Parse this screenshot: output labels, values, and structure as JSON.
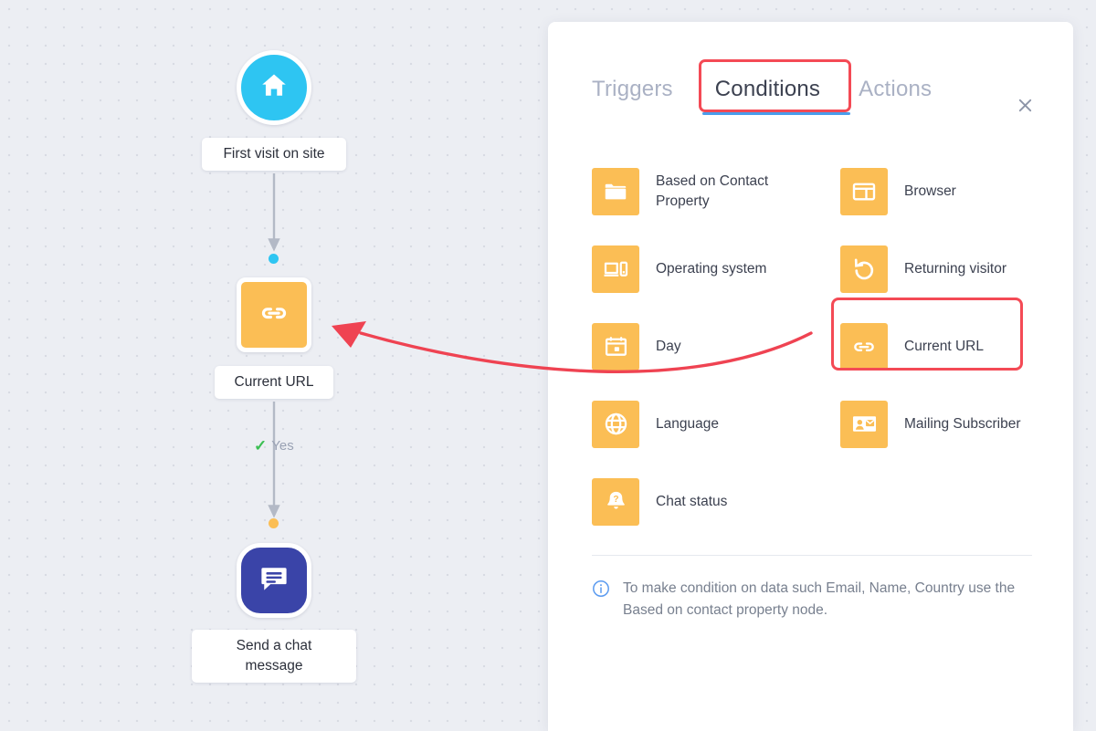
{
  "canvas": {
    "nodes": [
      {
        "id": "first-visit",
        "label": "First visit on site",
        "icon": "home-icon",
        "color": "#2ec5f2",
        "shape": "circle"
      },
      {
        "id": "current-url",
        "label": "Current URL",
        "icon": "link-icon",
        "color": "#fbbe55",
        "shape": "square"
      },
      {
        "id": "send-chat",
        "label": "Send a chat message",
        "icon": "chat-message-icon",
        "color": "#3a44a8",
        "shape": "rounded"
      }
    ],
    "branch_label": "Yes",
    "markers": [
      {
        "id": "marker-blue",
        "color": "#2ec5f2"
      },
      {
        "id": "marker-orange",
        "color": "#fbbe55"
      }
    ]
  },
  "panel": {
    "tabs": [
      {
        "id": "triggers",
        "label": "Triggers",
        "active": false
      },
      {
        "id": "conditions",
        "label": "Conditions",
        "active": true
      },
      {
        "id": "actions",
        "label": "Actions",
        "active": false
      }
    ],
    "close_label": "×",
    "conditions": [
      {
        "id": "based-on-contact-property",
        "label": "Based on Contact Property",
        "icon": "folder-icon",
        "column": "left"
      },
      {
        "id": "browser",
        "label": "Browser",
        "icon": "browser-icon",
        "column": "right"
      },
      {
        "id": "operating-system",
        "label": "Operating system",
        "icon": "devices-icon",
        "column": "left"
      },
      {
        "id": "returning-visitor",
        "label": "Returning visitor",
        "icon": "refresh-back-icon",
        "column": "right"
      },
      {
        "id": "day",
        "label": "Day",
        "icon": "calendar-icon",
        "column": "left"
      },
      {
        "id": "current-url",
        "label": "Current URL",
        "icon": "link-icon",
        "column": "right"
      },
      {
        "id": "language",
        "label": "Language",
        "icon": "globe-icon",
        "column": "left"
      },
      {
        "id": "mailing-subscriber",
        "label": "Mailing Subscriber",
        "icon": "contact-card-icon",
        "column": "right"
      },
      {
        "id": "chat-status",
        "label": "Chat status",
        "icon": "bell-question-icon",
        "column": "left"
      }
    ],
    "note": "To make condition on data such Email, Name, Country use the Based on contact property node."
  },
  "annotations": {
    "highlight_color": "#f44a55",
    "arrow_color": "#ef4352",
    "accent_underline": "#4a9dec",
    "icon_orange": "#fbbe55"
  }
}
